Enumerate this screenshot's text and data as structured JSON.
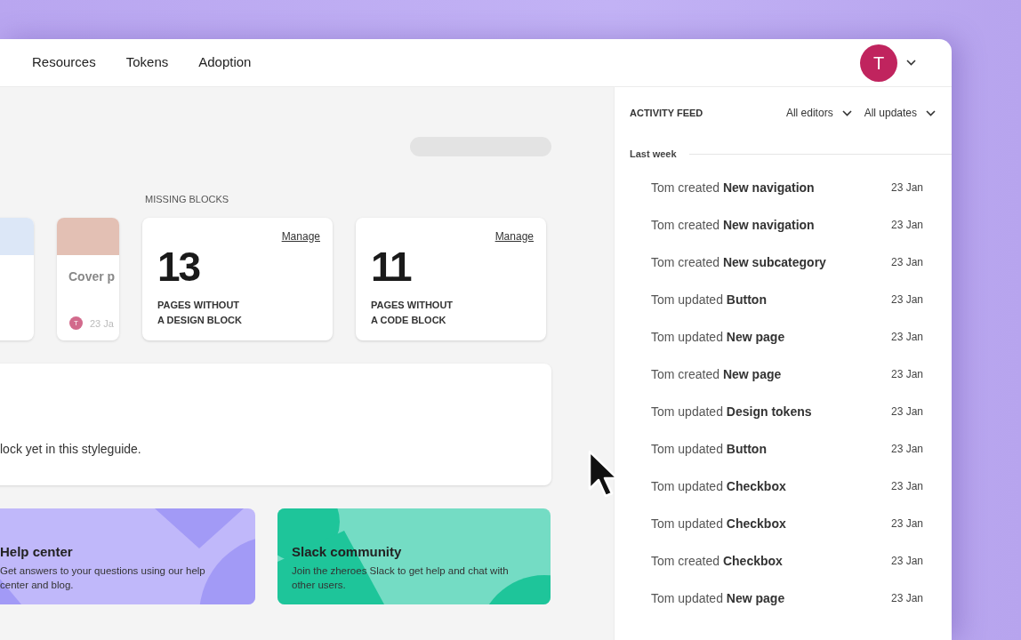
{
  "nav": {
    "items": [
      {
        "label": "Resources",
        "selected": false
      },
      {
        "label": "Tokens",
        "selected": false
      },
      {
        "label": "Adoption",
        "selected": false
      }
    ],
    "avatar": {
      "initial": "T"
    }
  },
  "main": {
    "section_label": "MISSING BLOCKS",
    "page_cards": [
      {
        "color": "#dce7f7"
      },
      {
        "color": "#e3c0b4",
        "title": "Cover p",
        "author_initial": "T",
        "date": "23 Ja"
      }
    ],
    "metrics": [
      {
        "count": "13",
        "label_lines": [
          "PAGES WITHOUT",
          "A DESIGN BLOCK"
        ],
        "action": "Manage"
      },
      {
        "count": "11",
        "label_lines": [
          "PAGES WITHOUT",
          "A CODE BLOCK"
        ],
        "action": "Manage"
      }
    ],
    "empty_state": "lock yet in this styleguide.",
    "resources": [
      {
        "kind": "help",
        "title": "Help center",
        "description": "Get answers to your questions using our help center and blog."
      },
      {
        "kind": "slack",
        "title": "Slack community",
        "description": "Join the zheroes Slack to get help and chat with other users."
      }
    ]
  },
  "activity_feed": {
    "title": "ACTIVITY FEED",
    "filters": [
      {
        "label": "All editors"
      },
      {
        "label": "All updates"
      }
    ],
    "group": "Last week",
    "items": [
      {
        "text": "Tom created **New navigation**",
        "date": "23 Jan"
      },
      {
        "text": "Tom created **New navigation**",
        "date": "23 Jan"
      },
      {
        "text": "Tom created **New subcategory**",
        "date": "23 Jan"
      },
      {
        "text": "Tom updated **Button**",
        "date": "23 Jan"
      },
      {
        "text": "Tom updated **New page**",
        "date": "23 Jan"
      },
      {
        "text": "Tom created **New page**",
        "date": "23 Jan"
      },
      {
        "text": "Tom updated **Design tokens**",
        "date": "23 Jan"
      },
      {
        "text": "Tom updated **Button**",
        "date": "23 Jan"
      },
      {
        "text": "Tom updated **Checkbox**",
        "date": "23 Jan"
      },
      {
        "text": "Tom updated **Checkbox**",
        "date": "23 Jan"
      },
      {
        "text": "Tom created **Checkbox**",
        "date": "23 Jan"
      },
      {
        "text": "Tom updated **New page**",
        "date": "23 Jan"
      }
    ]
  }
}
